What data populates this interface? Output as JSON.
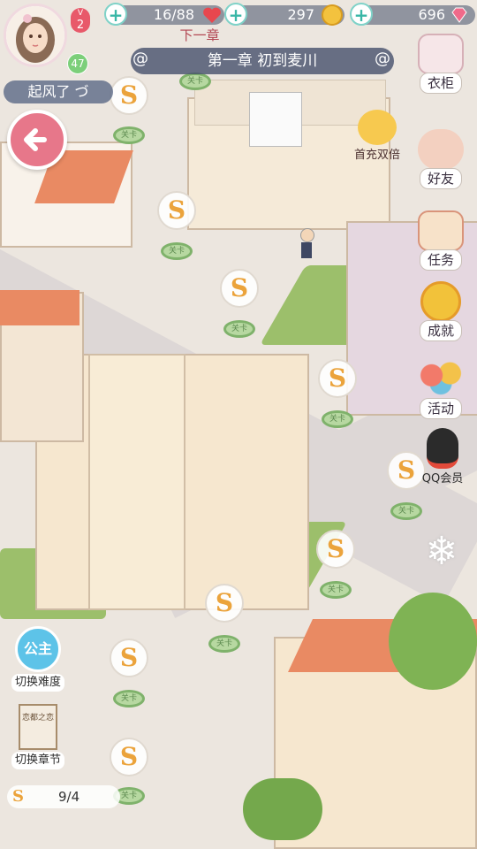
{
  "player": {
    "vip_level": "2",
    "level": "47",
    "name": "起风了 づ"
  },
  "resources": {
    "stamina": "16/88",
    "coins": "297",
    "diamonds": "696"
  },
  "chapter": {
    "next_label": "下一章",
    "title": "第一章 初到麦川"
  },
  "side_menu": [
    {
      "label": "衣柜",
      "icon": "wardrobe-icon"
    },
    {
      "label": "首充双倍",
      "icon": "piggy-bank-icon"
    },
    {
      "label": "好友",
      "icon": "friends-icon"
    },
    {
      "label": "任务",
      "icon": "book-icon"
    },
    {
      "label": "成就",
      "icon": "medal-icon"
    },
    {
      "label": "活动",
      "icon": "balloons-icon"
    },
    {
      "label": "QQ会员",
      "icon": "qq-penguin-icon"
    }
  ],
  "left_menu": {
    "difficulty_badge": "公主",
    "difficulty_label": "切换难度",
    "chapter_book": "恋都之恋",
    "chapter_label": "切换章节"
  },
  "stage_progress": "9/4",
  "level_marker": "S",
  "node_label": "关卡",
  "colors": {
    "accent_red": "#e8596a",
    "teal": "#39b7a7",
    "coin_gold": "#eba33b",
    "grass": "#9cbf6b",
    "roof": "#e98a63"
  }
}
